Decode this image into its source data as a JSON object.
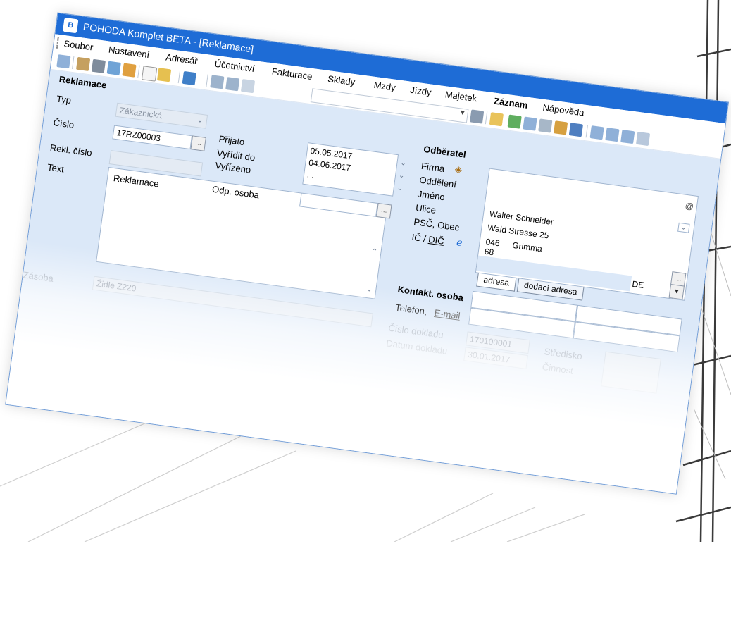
{
  "window": {
    "title": "POHODA Komplet BETA - [Reklamace]",
    "app_icon": "pohoda-app-icon",
    "accent": "#1e6cd6"
  },
  "menu": {
    "items": [
      "Soubor",
      "Nastavení",
      "Adresář",
      "Účetnictví",
      "Fakturace",
      "Sklady",
      "Mzdy",
      "Jízdy",
      "Majetek",
      "Záznam",
      "Nápověda"
    ]
  },
  "form": {
    "section_title": "Reklamace",
    "typ_label": "Typ",
    "typ_value": "Zákaznická",
    "cislo_label": "Číslo",
    "cislo_value": "17RZ00003",
    "rekl_cislo_label": "Rekl. číslo",
    "text_label": "Text",
    "text_value": "Reklamace",
    "prijato_label": "Přijato",
    "vyridit_label": "Vyřídit do",
    "vyrizeno_label": "Vyřízeno",
    "prijato_value": "05.05.2017",
    "vyridit_value": "04.06.2017",
    "vyrizeno_value": ". .",
    "odp_osoba_label": "Odp. osoba",
    "zasoba_label": "Zásoba",
    "zasoba_value": "Židle Z220"
  },
  "odberatel": {
    "title": "Odběratel",
    "firma_label": "Firma",
    "oddeleni_label": "Oddělení",
    "jmeno_label": "Jméno",
    "ulice_label": "Ulice",
    "psc_obec_label": "PSČ, Obec",
    "ic_label": "IČ / ",
    "dic_label": "DIČ",
    "at_symbol": "@",
    "jmeno_value": "Walter Schneider",
    "ulice_value": "Wald Strasse 25",
    "psc_value": "046 68",
    "obec_value": "Grimma",
    "country_value": "DE",
    "tab_adresa": "adresa",
    "tab_dodaci": "dodací adresa"
  },
  "contact": {
    "kontakt_label": "Kontakt. osoba",
    "telefon_label": "Telefon,",
    "email_label": "E-mail",
    "cislo_dokladu_label": "Číslo dokladu",
    "datum_dokladu_label": "Datum dokladu",
    "cislo_dokladu_value": "170100001",
    "datum_dokladu_value": "30.01.2017",
    "stredisko_label": "Středisko",
    "cinnost_label": "Činnost"
  }
}
